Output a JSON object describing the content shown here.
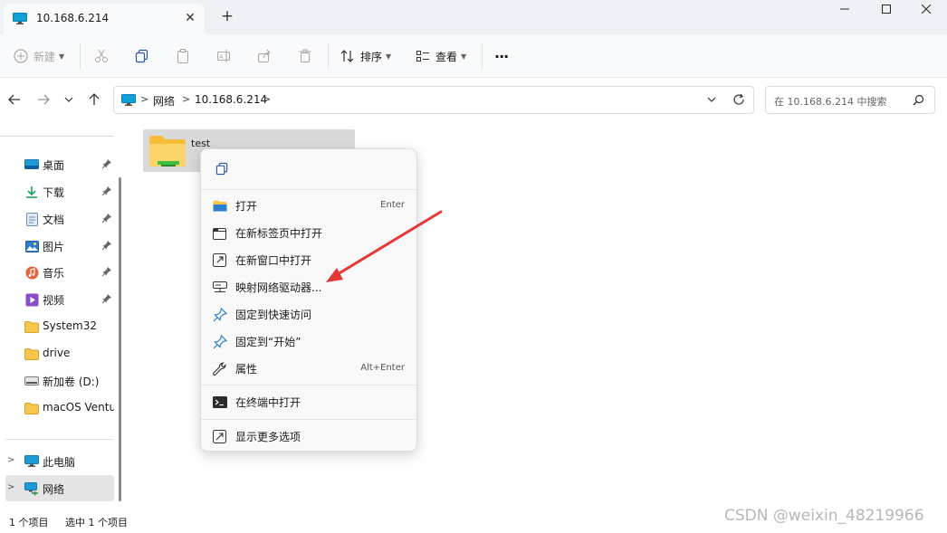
{
  "tab": {
    "title": "10.168.6.214",
    "close": "✕",
    "new": "+"
  },
  "toolbar": {
    "new_label": "新建",
    "sort_label": "排序",
    "view_label": "查看",
    "more": "···"
  },
  "address": {
    "crumbs": [
      "网络",
      "10.168.6.214"
    ],
    "separator": ">",
    "search_placeholder": "在 10.168.6.214 中搜索"
  },
  "sidebar": {
    "items": [
      {
        "label": "桌面"
      },
      {
        "label": "下载"
      },
      {
        "label": "文档"
      },
      {
        "label": "图片"
      },
      {
        "label": "音乐"
      },
      {
        "label": "视频"
      },
      {
        "label": "System32"
      },
      {
        "label": "drive"
      },
      {
        "label": "新加卷 (D:)"
      },
      {
        "label": "macOS Ventura"
      },
      {
        "label": "此电脑"
      },
      {
        "label": "网络"
      }
    ],
    "expand": ">"
  },
  "content": {
    "file_name": "test"
  },
  "status": {
    "count": "1 个项目",
    "selected": "选中 1 个项目"
  },
  "context_menu": {
    "items": [
      {
        "label": "打开",
        "shortcut": "Enter"
      },
      {
        "label": "在新标签页中打开"
      },
      {
        "label": "在新窗口中打开"
      },
      {
        "label": "映射网络驱动器..."
      },
      {
        "label": "固定到快速访问"
      },
      {
        "label": "固定到“开始”"
      },
      {
        "label": "属性",
        "shortcut": "Alt+Enter"
      },
      {
        "label": "在终端中打开"
      },
      {
        "label": "显示更多选项"
      }
    ]
  },
  "watermark": "CSDN @weixin_48219966",
  "colors": {
    "accent": "#0f6cbd",
    "folder": "#f7c64a",
    "arrow": "#e53935"
  }
}
